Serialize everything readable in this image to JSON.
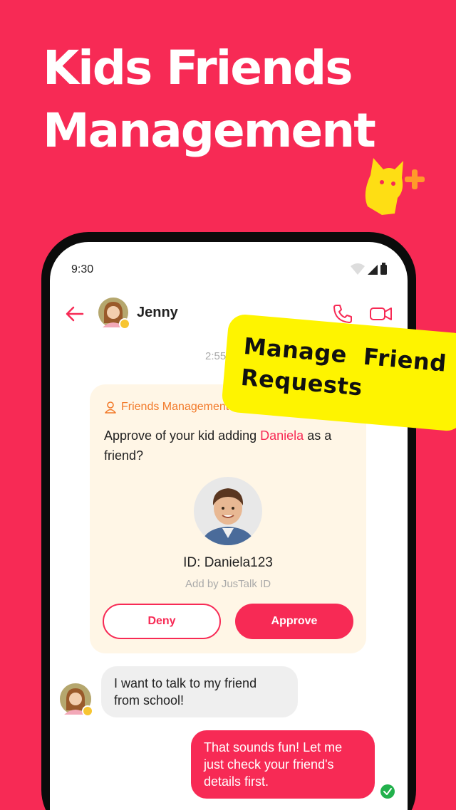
{
  "headline": {
    "line1": "Kids Friends",
    "line2": "Management"
  },
  "sticker": {
    "line1": "Manage  Friend",
    "line2": "Requests"
  },
  "status_bar": {
    "time": "9:30"
  },
  "chat_header": {
    "contact_name": "Jenny"
  },
  "conversation": {
    "timestamp": "2:55",
    "friend_request": {
      "header": "Friends Management",
      "question_prefix": "Approve of your kid adding ",
      "friend_name": "Daniela",
      "question_suffix": " as a friend?",
      "friend_id": "ID: Daniela123",
      "source": "Add by JusTalk ID",
      "deny_label": "Deny",
      "approve_label": "Approve"
    },
    "incoming_message": "I want to talk to my friend from school!",
    "outgoing_message": "That sounds fun! Let me just check your friend's details first."
  },
  "colors": {
    "brand": "#f72a55",
    "sticker": "#fef400",
    "card_bg": "#fff6e6",
    "card_header": "#f27a2a",
    "read_check": "#22b14c"
  }
}
